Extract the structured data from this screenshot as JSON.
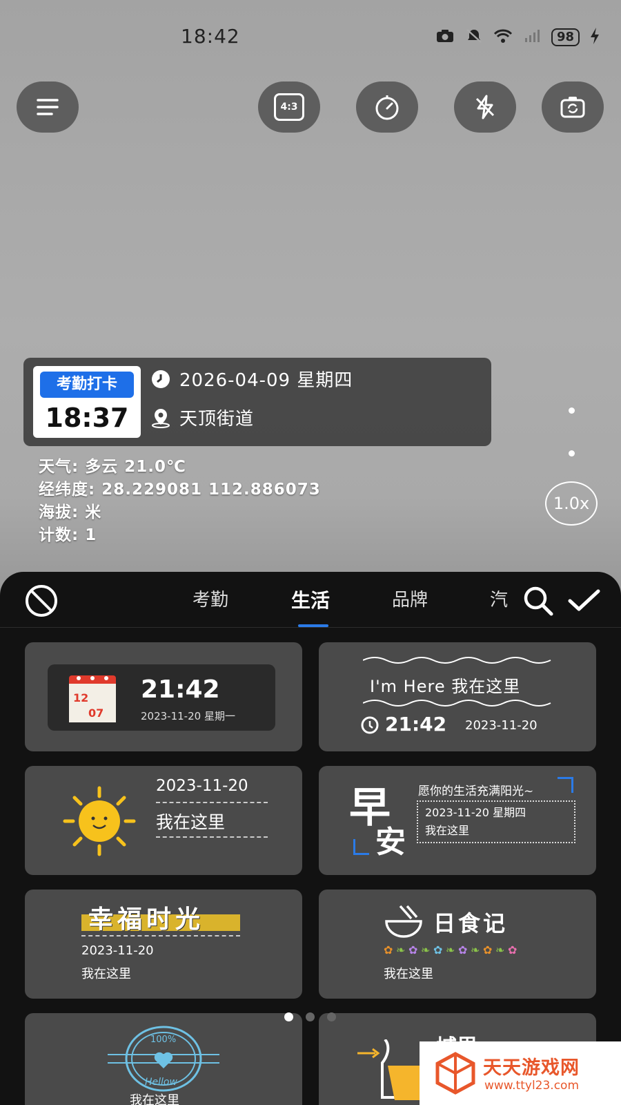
{
  "status_bar": {
    "time": "18:42",
    "battery": "98"
  },
  "watermark": {
    "badge_title": "考勤打卡",
    "badge_time": "18:37",
    "date": "2026-04-09 星期四",
    "location": "天顶街道",
    "weather": "天气: 多云 21.0℃",
    "coordinates": "经纬度: 28.229081 112.886073",
    "altitude": "海拔: 米",
    "count": "计数: 1"
  },
  "aspect_label": "4:3",
  "zoom_label": "1.0x",
  "tabs": [
    {
      "label": "考勤",
      "active": false
    },
    {
      "label": "生活",
      "active": true
    },
    {
      "label": "品牌",
      "active": false
    },
    {
      "label": "汽",
      "active": false
    }
  ],
  "cards": {
    "c1": {
      "time": "21:42",
      "date": "2023-11-20 星期一",
      "cal_top": "12",
      "cal_bottom": "07"
    },
    "c2": {
      "line1": "I'm Here 我在这里",
      "time": "21:42",
      "date": "2023-11-20"
    },
    "c3": {
      "date": "2023-11-20",
      "label": "我在这里"
    },
    "c4": {
      "big1": "早",
      "big2": "安",
      "slogan": "愿你的生活充满阳光~",
      "date": "2023-11-20 星期四",
      "label": "我在这里"
    },
    "c5": {
      "title": "幸福时光",
      "date": "2023-11-20",
      "label": "我在这里"
    },
    "c6": {
      "title": "日食记",
      "label": "我在这里"
    },
    "c7": {
      "stamp_top": "100%",
      "stamp_bottom": "Hellow",
      "label": "我在这里"
    },
    "c8": {
      "label": "城里"
    }
  },
  "brand": {
    "name": "天天游戏网",
    "url": "www.ttyl23.com"
  },
  "colors": {
    "accent_blue": "#1e6fe8",
    "brand_orange": "#e8572b",
    "card_bg": "#4a4a4a"
  }
}
